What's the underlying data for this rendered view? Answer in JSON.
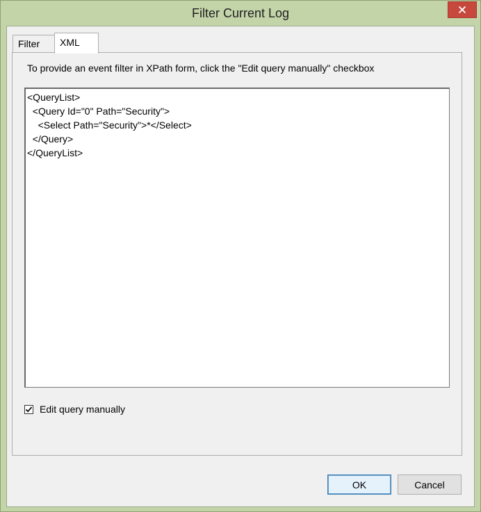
{
  "window": {
    "title": "Filter Current Log",
    "close_label": "×"
  },
  "tabs": [
    {
      "label": "Filter",
      "selected": false
    },
    {
      "label": "XML",
      "selected": true
    }
  ],
  "xml_tab": {
    "instruction": "To provide an event filter in XPath form, click the \"Edit query manually\" checkbox",
    "query_text": "<QueryList>\n  <Query Id=\"0\" Path=\"Security\">\n    <Select Path=\"Security\">*</Select>\n  </Query>\n</QueryList>",
    "edit_manually": {
      "label": "Edit query manually",
      "checked": true
    }
  },
  "buttons": {
    "ok_label": "OK",
    "cancel_label": "Cancel"
  },
  "colors": {
    "frame": "#c4d4a9",
    "close_button": "#c7483d",
    "dialog_background": "#f0f0f0",
    "ok_border": "#3c7fb1"
  },
  "icons": {
    "close": "close-icon",
    "checkbox": "checkmark-icon"
  }
}
